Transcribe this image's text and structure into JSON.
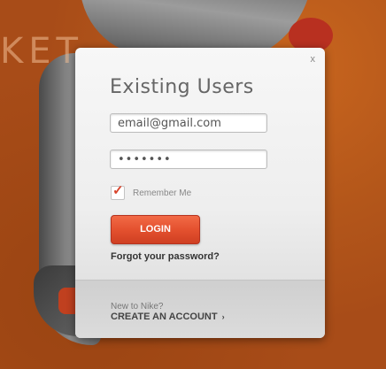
{
  "background": {
    "brand_text": "KET"
  },
  "modal": {
    "close_label": "x",
    "title": "Existing Users",
    "email": {
      "value": "email@gmail.com"
    },
    "password": {
      "value": "•••••••"
    },
    "remember": {
      "label": "Remember Me",
      "checked": true
    },
    "login_label": "LOGIN",
    "forgot_label": "Forgot your password?",
    "footer": {
      "prompt": "New to Nike?",
      "create_label": "CREATE AN ACCOUNT",
      "chevron": "›"
    }
  },
  "colors": {
    "accent": "#e4512f",
    "background": "#a84c18"
  }
}
